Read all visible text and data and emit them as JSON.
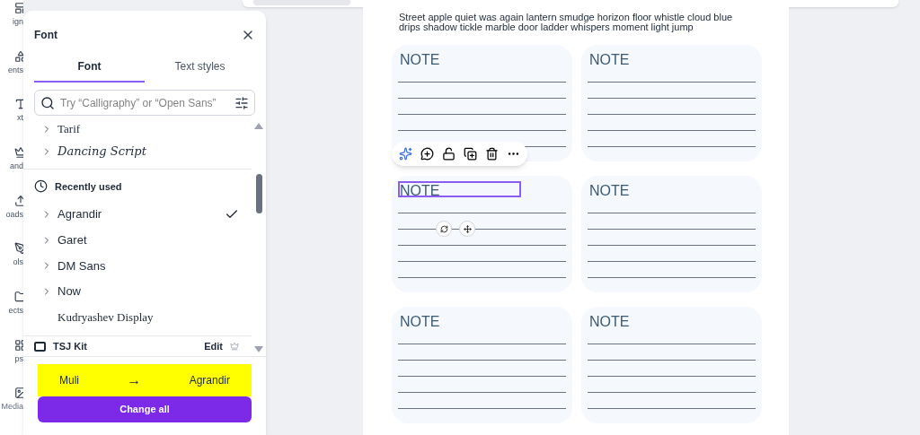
{
  "rail": [
    "ign",
    "ents",
    "xt",
    "and",
    "oads",
    "ols",
    "ects",
    "ps",
    "Media"
  ],
  "panel": {
    "title": "Font",
    "tabs": [
      {
        "label": "Font",
        "selected": true
      },
      {
        "label": "Text styles",
        "selected": false
      }
    ],
    "search": {
      "placeholder": "Try “Calligraphy” or “Open Sans”"
    },
    "fonts_top": [
      {
        "name": "Tarif",
        "kind": "serif",
        "expandable": true,
        "checked": false
      },
      {
        "name": "Dancing Script",
        "kind": "script",
        "expandable": true,
        "checked": false
      }
    ],
    "recent": {
      "title": "Recently used",
      "fonts": [
        {
          "name": "Agrandir",
          "kind": "sans",
          "expandable": true,
          "checked": true
        },
        {
          "name": "Garet",
          "kind": "sans",
          "expandable": true,
          "checked": false
        },
        {
          "name": "DM Sans",
          "kind": "sans",
          "expandable": true,
          "checked": false
        },
        {
          "name": "Now",
          "kind": "sans",
          "expandable": true,
          "checked": false
        },
        {
          "name": "Kudryashev Display",
          "kind": "serif",
          "expandable": false,
          "checked": false
        }
      ]
    },
    "kit": {
      "name": "TSJ Kit",
      "action": "Edit"
    },
    "replace": {
      "from": "Muli",
      "arrow": "→",
      "to": "Agrandir"
    },
    "button": "Change all"
  },
  "page": {
    "text": "Street apple quiet was again lantern smudge horizon floor whistle cloud blue drips shadow tickle marble door ladder whispers moment light jump",
    "notes": [
      {
        "title": "NOTE",
        "selected": false
      },
      {
        "title": "NOTE",
        "selected": false
      },
      {
        "title": "NOTE",
        "selected": true
      },
      {
        "title": "NOTE",
        "selected": false
      },
      {
        "title": "NOTE",
        "selected": false
      },
      {
        "title": "NOTE",
        "selected": false
      }
    ]
  }
}
